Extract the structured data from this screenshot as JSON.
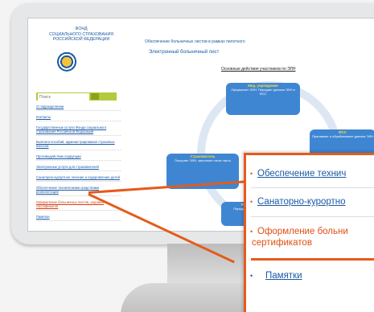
{
  "site": {
    "fund_name_lines": [
      "ФОНД",
      "СОЦИАЛЬНОГО СТРАХОВАНИЯ",
      "РОССИЙСКОЙ ФЕДЕРАЦИИ"
    ],
    "search_placeholder": "Поиск",
    "top_link": "Обеспечение больничных листов в рамках пилотного",
    "page_title": "Электронный больничный лист",
    "left_menu": [
      "О подразделении",
      "Контакты",
      "Государственные услуги Фонда социального страхования Российской Федерации",
      "Выплата пособий, администрирование страховых взносов",
      "Противодействие коррупции",
      "Электронные услуги для страхователей",
      "Санаторно-курортное лечение и оздоровление детей",
      "Обеспечение техническими средствами реабилитации",
      "Оформление больничных листов, родовых сертификатов",
      "Памятки"
    ],
    "active_menu_index": 8
  },
  "diagram": {
    "title": "Основные действия участников по ЭЛН",
    "boxes": [
      {
        "title": "Мед. учреждение",
        "text": "Оформляет ЭЛН. Передает данные ЭЛН в ФСС"
      },
      {
        "title": "ФСС",
        "text": "Принимает и обрабатывает данные ЭЛН"
      },
      {
        "title": "Страхователь",
        "text": "Получает ЭЛН, заполняет свою часть"
      },
      {
        "title": "Работодатель",
        "text": "Передает сведения в ФСС"
      }
    ]
  },
  "callout": {
    "items": [
      "Обеспечение технич",
      "Санаторно-курортно",
      "Оформление больни",
      "сертификатов",
      "Памятки"
    ],
    "active_index": 2
  },
  "colors": {
    "accent": "#e55b1c",
    "link": "#1b5aa6",
    "search_bar": "#b4ca3a"
  }
}
